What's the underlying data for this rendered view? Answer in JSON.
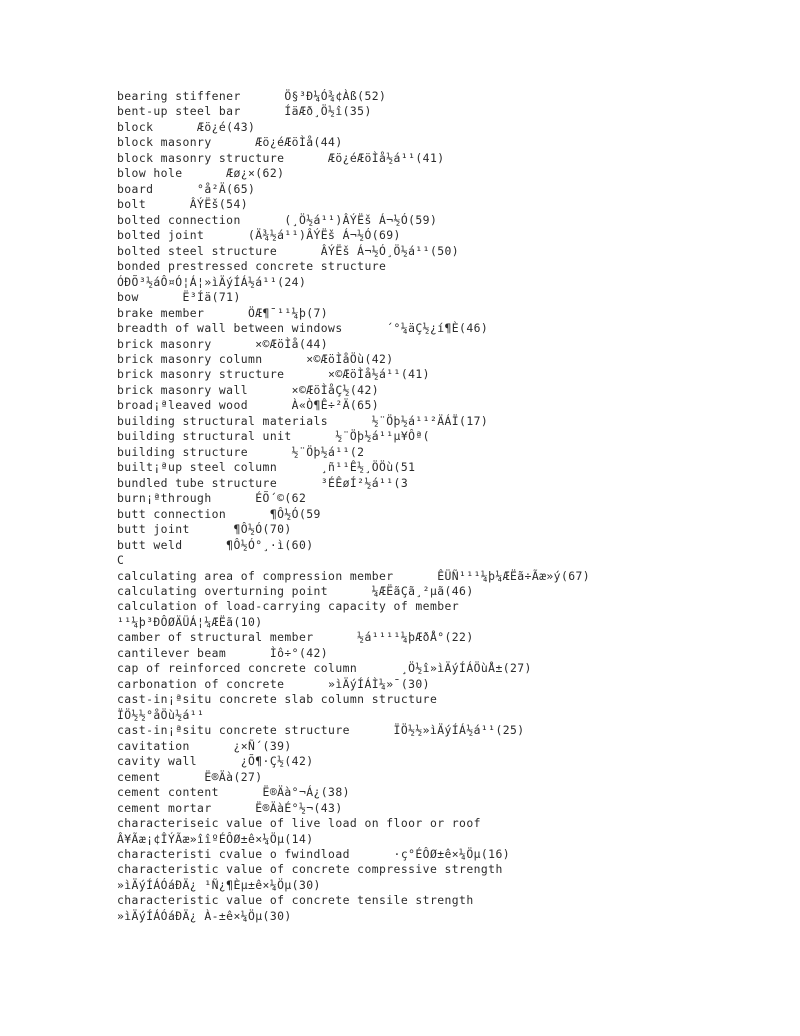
{
  "document": {
    "type": "scanned-glossary-page",
    "page_background": "#ffffff",
    "text_color": "#2a2a2a",
    "lines": [
      "bearing stiffener      Ö§³Ð¼Ó¾¢Àß(52)",
      "bent-up steel bar      ÍäÆð¸Ö½î(35)",
      "block      Æö¿é(43)",
      "block masonry      Æö¿éÆöÌå(44)",
      "block masonry structure      Æö¿éÆöÌå½á¹¹(41)",
      "blow hole      Æø¿×(62)",
      "board      °å²Ä(65)",
      "bolt      ÂÝËš(54)",
      "bolted connection      (¸Ö½á¹¹)ÂÝËš Á¬½Ó(59)",
      "bolted joint      (Ä¾½á¹¹)ÂÝËš Á¬½Ó(69)",
      "bolted steel structure      ÂÝËš Á¬½Ó¸Ö½á¹¹(50)",
      "bonded prestressed concrete structure",
      "ÓÐÕ³½áÔ¤Ó¦Á¦»ìÄýÍÁ½á¹¹(24)",
      "bow      Ë³Íä(71)",
      "brake member      ÖÆ¶¯¹¹¼þ(7)",
      "breadth of wall between windows      ´°¼äÇ½¿í¶È(46)",
      "brick masonry      ×©ÆöÌå(44)",
      "brick masonry column      ×©ÆöÌåÖù(42)",
      "brick masonry structure      ×©ÆöÌå½á¹¹(41)",
      "brick masonry wall      ×©ÆöÌåÇ½(42)",
      "broad¡ªleaved wood      À«Ò¶Ê÷²Ä(65)",
      "building structural materials      ½¨Öþ½á¹¹²ÄÁÏ(17)",
      "building structural unit      ½¨Öþ½á¹¹µ¥Ôª(",
      "building structure      ½¨Öþ½á¹¹(2",
      "built¡ªup steel column      ¸ñ¹¹Ê½¸ÖÖù(51",
      "bundled tube structure      ³ÉÊøÍ²½á¹¹(3",
      "burn¡ªthrough      ÉÕ´©(62",
      "butt connection      ¶Ô½Ó(59",
      "butt joint      ¶Ô½Ó(70)",
      "butt weld      ¶Ô½Ó°¸·ì(60)",
      "C",
      "calculating area of compression member      ÊÜÑ¹¹¹¼þ¼ÆËã÷Ãæ»ý(67)",
      "calculating overturning point      ¼ÆËãÇã¸²µã(46)",
      "calculation of load-carrying capacity of member",
      "¹¹¼þ³ÐÔØÄÜÁ¦¼ÆËã(10)",
      "camber of structural member      ½á¹¹¹¹¼þÆðÅ°(22)",
      "cantilever beam      Ìô÷°(42)",
      "cap of reinforced concrete column      ¸Ö½î»ìÄýÍÁÖùÅ±(27)",
      "carbonation of concrete      »ìÄýÍÁÌ¼»¯(30)",
      "cast-in¡ªsitu concrete slab column structure",
      "ÏÖ½½°åÖù½á¹¹",
      "cast-in¡ªsitu concrete structure      ÏÖ½½»ìÄýÍÁ½á¹¹(25)",
      "cavitation      ¿×Ñ´(39)",
      "cavity wall      ¿Õ¶·Ç½(42)",
      "cement      Ë®Äà(27)",
      "cement content      Ë®Äà°¬Á¿(38)",
      "cement mortar      Ë®ÄàÉ°½¬(43)",
      "characteriseic value of live load on floor or roof",
      "Â¥Ãæ¡¢ÎÝÃæ»îîºÉÔØ±ê×¼Öµ(14)",
      "characteristi cvalue o fwindload      ·ç°ÉÔØ±ê×¼Öµ(16)",
      "characteristic value of concrete compressive strength",
      "»ìÄýÍÁÓáÐÄ¿ ¹Ñ¿¶Èµ±ê×¼Öµ(30)",
      "characteristic value of concrete tensile strength",
      "»ìÄýÍÁÓáÐÄ¿ À-±ê×¼Öµ(30)"
    ]
  }
}
